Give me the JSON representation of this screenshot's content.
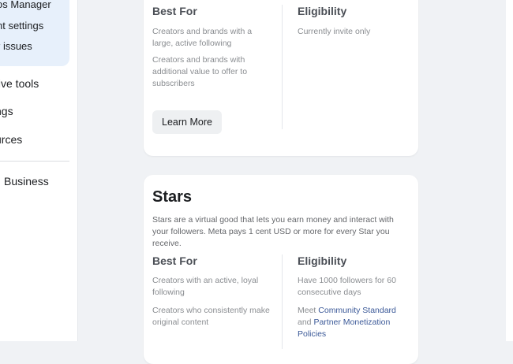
{
  "sidebar": {
    "sub_items": [
      "os Manager",
      "nt settings",
      "r issues"
    ],
    "items": [
      "tive tools",
      "ngs",
      "urces",
      "Business"
    ]
  },
  "card1": {
    "best_for": {
      "heading": "Best For",
      "items": [
        "Creators and brands with a large, active following",
        "Creators and brands with additional value to offer to subscribers"
      ]
    },
    "eligibility": {
      "heading": "Eligibility",
      "text": "Currently invite only"
    },
    "button_label": "Learn More"
  },
  "card2": {
    "title": "Stars",
    "description": "Stars are a virtual good that lets you earn money and interact with your followers. Meta pays 1 cent USD or more for every Star you receive.",
    "best_for": {
      "heading": "Best For",
      "items": [
        "Creators with an active, loyal following",
        "Creators who consistently make original content"
      ]
    },
    "eligibility": {
      "heading": "Eligibility",
      "requirement": "Have 1000 followers for 60 consecutive days",
      "meet_prefix": "Meet ",
      "link1": "Community Standard",
      "and_text": " and ",
      "link2": "Partner Monetization Policies"
    }
  },
  "colors": {
    "accent": "#3b5998",
    "sidebar_highlight": "#e7f0fb",
    "background": "#f0f2f5"
  }
}
